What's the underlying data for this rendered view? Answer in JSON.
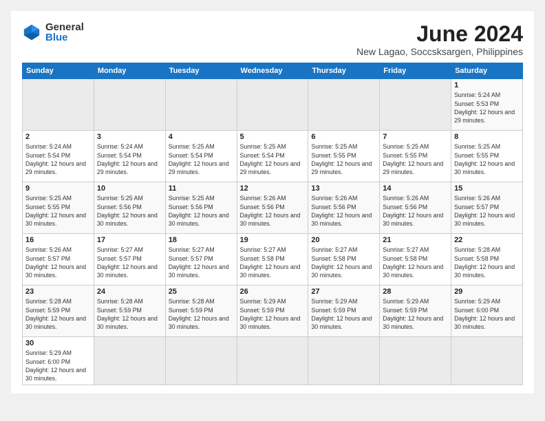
{
  "logo": {
    "general": "General",
    "blue": "Blue"
  },
  "header": {
    "month": "June 2024",
    "location": "New Lagao, Soccsksargen, Philippines"
  },
  "weekdays": [
    "Sunday",
    "Monday",
    "Tuesday",
    "Wednesday",
    "Thursday",
    "Friday",
    "Saturday"
  ],
  "weeks": [
    [
      {
        "day": "",
        "info": ""
      },
      {
        "day": "",
        "info": ""
      },
      {
        "day": "",
        "info": ""
      },
      {
        "day": "",
        "info": ""
      },
      {
        "day": "",
        "info": ""
      },
      {
        "day": "",
        "info": ""
      },
      {
        "day": "1",
        "info": "Sunrise: 5:24 AM\nSunset: 5:53 PM\nDaylight: 12 hours and 29 minutes."
      }
    ],
    [
      {
        "day": "2",
        "info": "Sunrise: 5:24 AM\nSunset: 5:54 PM\nDaylight: 12 hours and 29 minutes."
      },
      {
        "day": "3",
        "info": "Sunrise: 5:24 AM\nSunset: 5:54 PM\nDaylight: 12 hours and 29 minutes."
      },
      {
        "day": "4",
        "info": "Sunrise: 5:25 AM\nSunset: 5:54 PM\nDaylight: 12 hours and 29 minutes."
      },
      {
        "day": "5",
        "info": "Sunrise: 5:25 AM\nSunset: 5:54 PM\nDaylight: 12 hours and 29 minutes."
      },
      {
        "day": "6",
        "info": "Sunrise: 5:25 AM\nSunset: 5:55 PM\nDaylight: 12 hours and 29 minutes."
      },
      {
        "day": "7",
        "info": "Sunrise: 5:25 AM\nSunset: 5:55 PM\nDaylight: 12 hours and 29 minutes."
      },
      {
        "day": "8",
        "info": "Sunrise: 5:25 AM\nSunset: 5:55 PM\nDaylight: 12 hours and 30 minutes."
      }
    ],
    [
      {
        "day": "9",
        "info": "Sunrise: 5:25 AM\nSunset: 5:55 PM\nDaylight: 12 hours and 30 minutes."
      },
      {
        "day": "10",
        "info": "Sunrise: 5:25 AM\nSunset: 5:56 PM\nDaylight: 12 hours and 30 minutes."
      },
      {
        "day": "11",
        "info": "Sunrise: 5:25 AM\nSunset: 5:56 PM\nDaylight: 12 hours and 30 minutes."
      },
      {
        "day": "12",
        "info": "Sunrise: 5:26 AM\nSunset: 5:56 PM\nDaylight: 12 hours and 30 minutes."
      },
      {
        "day": "13",
        "info": "Sunrise: 5:26 AM\nSunset: 5:56 PM\nDaylight: 12 hours and 30 minutes."
      },
      {
        "day": "14",
        "info": "Sunrise: 5:26 AM\nSunset: 5:56 PM\nDaylight: 12 hours and 30 minutes."
      },
      {
        "day": "15",
        "info": "Sunrise: 5:26 AM\nSunset: 5:57 PM\nDaylight: 12 hours and 30 minutes."
      }
    ],
    [
      {
        "day": "16",
        "info": "Sunrise: 5:26 AM\nSunset: 5:57 PM\nDaylight: 12 hours and 30 minutes."
      },
      {
        "day": "17",
        "info": "Sunrise: 5:27 AM\nSunset: 5:57 PM\nDaylight: 12 hours and 30 minutes."
      },
      {
        "day": "18",
        "info": "Sunrise: 5:27 AM\nSunset: 5:57 PM\nDaylight: 12 hours and 30 minutes."
      },
      {
        "day": "19",
        "info": "Sunrise: 5:27 AM\nSunset: 5:58 PM\nDaylight: 12 hours and 30 minutes."
      },
      {
        "day": "20",
        "info": "Sunrise: 5:27 AM\nSunset: 5:58 PM\nDaylight: 12 hours and 30 minutes."
      },
      {
        "day": "21",
        "info": "Sunrise: 5:27 AM\nSunset: 5:58 PM\nDaylight: 12 hours and 30 minutes."
      },
      {
        "day": "22",
        "info": "Sunrise: 5:28 AM\nSunset: 5:58 PM\nDaylight: 12 hours and 30 minutes."
      }
    ],
    [
      {
        "day": "23",
        "info": "Sunrise: 5:28 AM\nSunset: 5:59 PM\nDaylight: 12 hours and 30 minutes."
      },
      {
        "day": "24",
        "info": "Sunrise: 5:28 AM\nSunset: 5:59 PM\nDaylight: 12 hours and 30 minutes."
      },
      {
        "day": "25",
        "info": "Sunrise: 5:28 AM\nSunset: 5:59 PM\nDaylight: 12 hours and 30 minutes."
      },
      {
        "day": "26",
        "info": "Sunrise: 5:29 AM\nSunset: 5:59 PM\nDaylight: 12 hours and 30 minutes."
      },
      {
        "day": "27",
        "info": "Sunrise: 5:29 AM\nSunset: 5:59 PM\nDaylight: 12 hours and 30 minutes."
      },
      {
        "day": "28",
        "info": "Sunrise: 5:29 AM\nSunset: 5:59 PM\nDaylight: 12 hours and 30 minutes."
      },
      {
        "day": "29",
        "info": "Sunrise: 5:29 AM\nSunset: 6:00 PM\nDaylight: 12 hours and 30 minutes."
      }
    ],
    [
      {
        "day": "30",
        "info": "Sunrise: 5:29 AM\nSunset: 6:00 PM\nDaylight: 12 hours and 30 minutes."
      },
      {
        "day": "",
        "info": ""
      },
      {
        "day": "",
        "info": ""
      },
      {
        "day": "",
        "info": ""
      },
      {
        "day": "",
        "info": ""
      },
      {
        "day": "",
        "info": ""
      },
      {
        "day": "",
        "info": ""
      }
    ]
  ]
}
